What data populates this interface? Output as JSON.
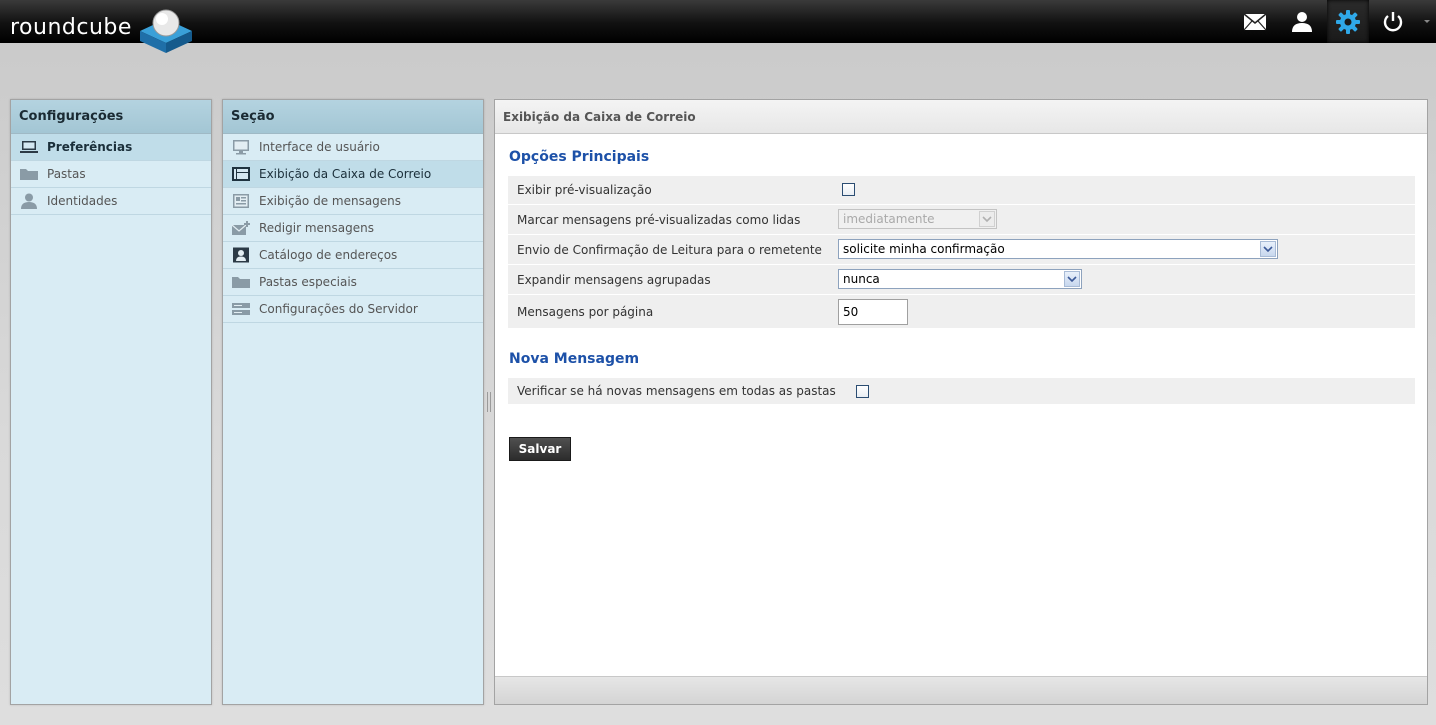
{
  "app": {
    "logo_text": "roundcube"
  },
  "topbar": {
    "buttons": [
      {
        "icon": "mail-icon",
        "label": "Mail"
      },
      {
        "icon": "contacts-icon",
        "label": "Contacts"
      },
      {
        "icon": "gear-icon",
        "label": "Settings",
        "active": true
      },
      {
        "icon": "power-icon",
        "label": "Logout"
      }
    ]
  },
  "config_panel": {
    "title": "Configurações",
    "items": [
      {
        "label": "Preferências",
        "icon": "laptop-icon",
        "selected": true
      },
      {
        "label": "Pastas",
        "icon": "folder-icon"
      },
      {
        "label": "Identidades",
        "icon": "person-icon"
      }
    ]
  },
  "section_panel": {
    "title": "Seção",
    "items": [
      {
        "label": "Interface de usuário",
        "icon": "monitor-icon"
      },
      {
        "label": "Exibição da Caixa de Correio",
        "icon": "mailbox-layout-icon",
        "selected": true
      },
      {
        "label": "Exibição de mensagens",
        "icon": "message-view-icon"
      },
      {
        "label": "Redigir mensagens",
        "icon": "compose-icon"
      },
      {
        "label": "Catálogo de endereços",
        "icon": "addressbook-icon"
      },
      {
        "label": "Pastas especiais",
        "icon": "folder-icon"
      },
      {
        "label": "Configurações do Servidor",
        "icon": "server-icon"
      }
    ]
  },
  "content": {
    "header": "Exibição da Caixa de Correio",
    "main_section": {
      "title": "Opções Principais",
      "preview_label": "Exibir pré-visualização",
      "preview_checked": false,
      "mark_read_label": "Marcar mensagens pré-visualizadas como lidas",
      "mark_read_value": "imediatamente",
      "receipt_label": "Envio de Confirmação de Leitura para o remetente",
      "receipt_value": "solicite minha confirmação",
      "expand_label": "Expandir mensagens agrupadas",
      "expand_value": "nunca",
      "pagesize_label": "Mensagens por página",
      "pagesize_value": "50"
    },
    "new_section": {
      "title": "Nova Mensagem",
      "check_all_label": "Verificar se há novas mensagens em todas as pastas",
      "check_all_checked": false
    },
    "save_label": "Salvar"
  },
  "colors": {
    "topbar": "#000000",
    "panel_bg": "#d9ecf4",
    "panel_header": "#a3c6d4",
    "section_title": "#1d51a8",
    "active_icon": "#2fa8e8"
  }
}
